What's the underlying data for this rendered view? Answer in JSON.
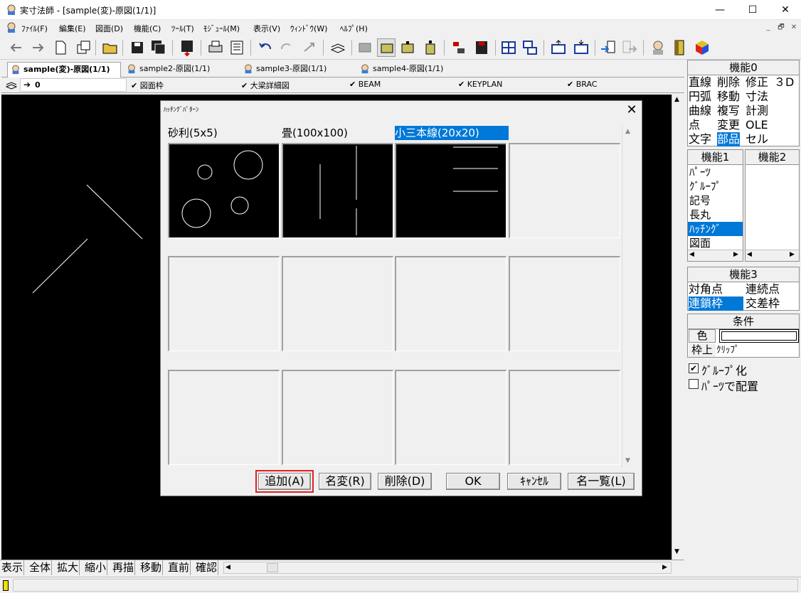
{
  "window": {
    "title": "実寸法師 - [sample(変)-原図(1/1)]",
    "minimize": "—",
    "maximize": "☐",
    "close": "✕"
  },
  "menu": [
    "ﾌｧｲﾙ(F)",
    "編集(E)",
    "図面(D)",
    "機能(C)",
    "ﾂｰﾙ(T)",
    "ﾓｼﾞｭｰﾙ(M)",
    "表示(V)",
    "ｳｨﾝﾄﾞｳ(W)",
    "ﾍﾙﾌﾟ(H)"
  ],
  "mdi_controls": [
    "_",
    "🗗",
    "✕"
  ],
  "tabs": [
    "sample(変)-原図(1/1)",
    "sample2-原図(1/1)",
    "sample3-原図(1/1)",
    "sample4-原図(1/1)"
  ],
  "layers": {
    "current": "0",
    "items": [
      "図面枠",
      "大梁詳細図",
      "BEAM",
      "KEYPLAN",
      "BRAC"
    ]
  },
  "bottom_buttons": [
    "表示",
    "全体",
    "拡大",
    "縮小",
    "再描",
    "移動",
    "直前",
    "確認"
  ],
  "panel0": {
    "header": "機能0",
    "cells": [
      [
        "直線",
        "削除",
        "修正",
        "３D"
      ],
      [
        "円弧",
        "移動",
        "寸法",
        ""
      ],
      [
        "曲線",
        "複写",
        "計測",
        ""
      ],
      [
        "点",
        "変更",
        "OLE",
        ""
      ],
      [
        "文字",
        "部品",
        "セル",
        ""
      ]
    ],
    "selected": "部品"
  },
  "panel1": {
    "header": "機能1",
    "items": [
      "ﾊﾟｰﾂ",
      "ｸﾞﾙｰﾌﾟ",
      "記号",
      "長丸",
      "ﾊｯﾁﾝｸﾞ",
      "図面"
    ],
    "selected": "ﾊｯﾁﾝｸﾞ"
  },
  "panel2": {
    "header": "機能2"
  },
  "panel3": {
    "header": "機能3",
    "items": [
      "対角点",
      "連続点",
      "連鎖枠",
      "交差枠"
    ],
    "selected": "連鎖枠"
  },
  "conditions": {
    "header": "条件",
    "color_label": "色",
    "frame_label": "枠上",
    "frame_value": "ｸﾘｯﾌﾟ",
    "group_label": "ｸﾞﾙｰﾌﾟ化",
    "group_checked": true,
    "parts_label": "ﾊﾟｰﾂで配置",
    "parts_checked": false
  },
  "dialog": {
    "title": "ﾊｯﾁﾝｸﾞﾊﾟﾀｰﾝ",
    "close": "✕",
    "patterns": [
      "砂利(5x5)",
      "畳(100x100)",
      "小三本線(20x20)"
    ],
    "selected_pattern": "小三本線(20x20)",
    "buttons": {
      "add": "追加(A)",
      "rename": "名変(R)",
      "delete": "削除(D)",
      "ok": "OK",
      "cancel": "ｷｬﾝｾﾙ",
      "namelist": "名一覧(L)"
    }
  },
  "colors": {
    "selection": "#0078d7",
    "canvas": "#000000",
    "highlight": "#e02020"
  }
}
